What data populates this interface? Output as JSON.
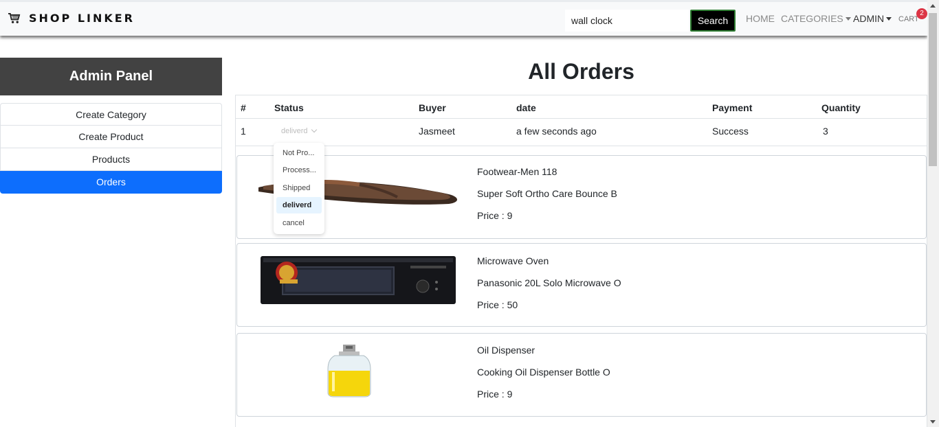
{
  "navbar": {
    "brand": "SHOP LINKER",
    "brand_icon": "cart-icon",
    "search_value": "wall clock",
    "search_button": "Search",
    "home": "HOME",
    "categories": "CATEGORIES",
    "admin": "ADMIN",
    "cart": "CART",
    "cart_count": "2"
  },
  "sidebar": {
    "title": "Admin Panel",
    "items": [
      {
        "label": "Create Category"
      },
      {
        "label": "Create Product"
      },
      {
        "label": "Products"
      },
      {
        "label": "Orders"
      }
    ]
  },
  "main": {
    "title": "All Orders",
    "columns": [
      "#",
      "Status",
      "Buyer",
      "date",
      "Payment",
      "Quantity"
    ],
    "order": {
      "index": "1",
      "status": "deliverd",
      "buyer": "Jasmeet",
      "date": "a few seconds ago",
      "payment": "Success",
      "quantity": "3"
    },
    "status_options": [
      "Not Pro...",
      "Process...",
      "Shipped",
      "deliverd",
      "cancel"
    ],
    "products": [
      {
        "name": "Footwear-Men 118",
        "description": "Super Soft Ortho Care Bounce B",
        "price": "Price : 9",
        "image": "sandal-image"
      },
      {
        "name": "Microwave Oven",
        "description": "Panasonic 20L Solo Microwave O",
        "price": "Price : 50",
        "image": "microwave-image"
      },
      {
        "name": "Oil Dispenser",
        "description": "Cooking Oil Dispenser Bottle O",
        "price": "Price : 9",
        "image": "oil-dispenser-image"
      }
    ]
  },
  "colors": {
    "active_blue": "#0d6efd",
    "sidebar_header": "#424242",
    "badge_red": "#dc3545",
    "selected_option": "#e6f4ff"
  }
}
